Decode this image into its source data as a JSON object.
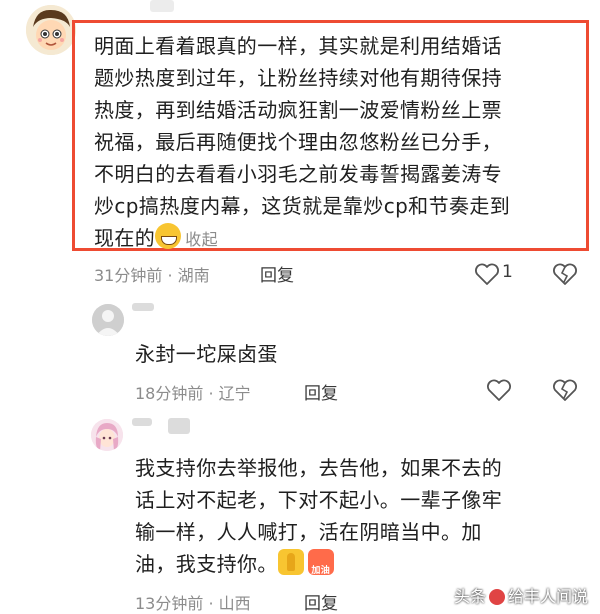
{
  "comments": [
    {
      "lines": [
        "明面上看着跟真的一样，其实就是利用结婚话",
        "题炒热度到过年，让粉丝持续对他有期待保持",
        "热度，再到结婚活动疯狂割一波爱情粉丝上票",
        "祝福，最后再随便找个理由忽悠粉丝已分手，",
        "不明白的去看看小羽毛之前发毒誓揭露姜涛专",
        "炒cp搞热度内幕，这货就是靠炒cp和节奏走到",
        "现在的"
      ],
      "collapse_label": "收起",
      "time": "31分钟前",
      "location": "湖南",
      "reply_label": "回复",
      "like_count": "1"
    },
    {
      "lines": [
        "永封一坨屎卤蛋"
      ],
      "time": "18分钟前",
      "location": "辽宁",
      "reply_label": "回复"
    },
    {
      "lines": [
        "我支持你去举报他，去告他，如果不去的",
        "话上对不起老，下对不起小。一辈子像牢",
        "输一样，人人喊打，活在阴暗当中。加",
        "油，我支持你。"
      ],
      "emoji_text": "加油",
      "time": "13分钟前",
      "location": "山西",
      "reply_label": "回复"
    }
  ],
  "watermark": {
    "left": "头条",
    "right": "给丰人间说"
  },
  "meta_sep": "·"
}
